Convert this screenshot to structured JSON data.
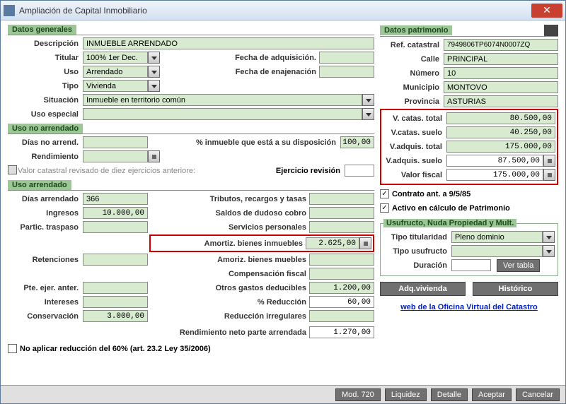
{
  "window": {
    "title": "Ampliación de Capital Inmobiliario"
  },
  "sections": {
    "generales": "Datos generales",
    "usonoarr": "Uso no arrendado",
    "usoarr": "Uso arrendado",
    "patrimonio": "Datos patrimonio",
    "usufructo": "Usufructo, Nuda Propiedad y Mult."
  },
  "labels": {
    "descripcion": "Descripción",
    "titular": "Titular",
    "uso": "Uso",
    "tipo": "Tipo",
    "situacion": "Situación",
    "usoespecial": "Uso especial",
    "fadq": "Fecha de adquisición.",
    "fenaj": "Fecha de enajenación",
    "dias_no_arr": "Días no arrend.",
    "rendimiento": "Rendimiento",
    "pct_inmueble": "% inmueble que está a su disposición",
    "valor_rev": "Valor catastral revisado de diez ejercicios anteriore:",
    "ejer_rev": "Ejercicio revisión",
    "dias_arr": "Días arrendado",
    "ingresos": "Ingresos",
    "partic": "Partic. traspaso",
    "retenciones": "Retenciones",
    "pte_ejer": "Pte. ejer. anter.",
    "intereses": "Intereses",
    "conservacion": "Conservación",
    "tributos": "Tributos, recargos y tasas",
    "saldos": "Saldos de dudoso cobro",
    "servicios": "Servicios personales",
    "amortiz_inm": "Amortiz. bienes inmuebles",
    "amortiz_mue": "Amoriz. bienes muebles",
    "comp_fiscal": "Compensación fiscal",
    "otros_gastos": "Otros gastos deducibles",
    "pct_reduc": "% Reducción",
    "reduc_irr": "Reducción irregulares",
    "rend_neto": "Rendimiento neto parte arrendada",
    "no_aplicar": "No aplicar reducción del 60% (art. 23.2 Ley 35/2006)",
    "ref_cat": "Ref. catastral",
    "calle": "Calle",
    "numero": "Número",
    "municipio": "Municipio",
    "provincia": "Provincia",
    "vcat_total": "V. catas. total",
    "vcat_suelo": "V.catas. suelo",
    "vadq_total": "V.adquis. total",
    "vadq_suelo": "V.adquis. suelo",
    "valor_fiscal": "Valor fiscal",
    "contrato_ant": "Contrato ant. a 9/5/85",
    "activo_calc": "Activo en cálculo de Patrimonio",
    "tipo_tit": "Tipo titularidad",
    "tipo_usu": "Tipo usufructo",
    "duracion": "Duración",
    "ver_tabla": "Ver tabla",
    "adq_viv": "Adq.vivienda",
    "historico": "Histórico",
    "web_cat": "web de la Oficina Virtual del Catastro"
  },
  "values": {
    "descripcion": "INMUEBLE ARRENDADO",
    "titular": "100% 1er Dec.",
    "uso": "Arrendado",
    "tipo": "Vivienda",
    "situacion": "Inmueble en territorio común",
    "pct_inmueble": "100,00",
    "dias_arr": "366",
    "ingresos": "10.000,00",
    "amortiz_inm": "2.625,00",
    "otros_gastos": "1.200,00",
    "pct_reduc": "60,00",
    "conservacion": "3.000,00",
    "rend_neto": "1.270,00",
    "ref_cat": "7949806TP6074N0007ZQ",
    "calle": "PRINCIPAL",
    "numero": "10",
    "municipio": "MONTOVO",
    "provincia": "ASTURIAS",
    "vcat_total": "80.500,00",
    "vcat_suelo": "40.250,00",
    "vadq_total": "175.000,00",
    "vadq_suelo": "87.500,00",
    "valor_fiscal": "175.000,00",
    "tipo_tit": "Pleno dominio"
  },
  "footer": {
    "mod720": "Mod. 720",
    "liquidez": "Liquidez",
    "detalle": "Detalle",
    "aceptar": "Aceptar",
    "cancelar": "Cancelar"
  }
}
